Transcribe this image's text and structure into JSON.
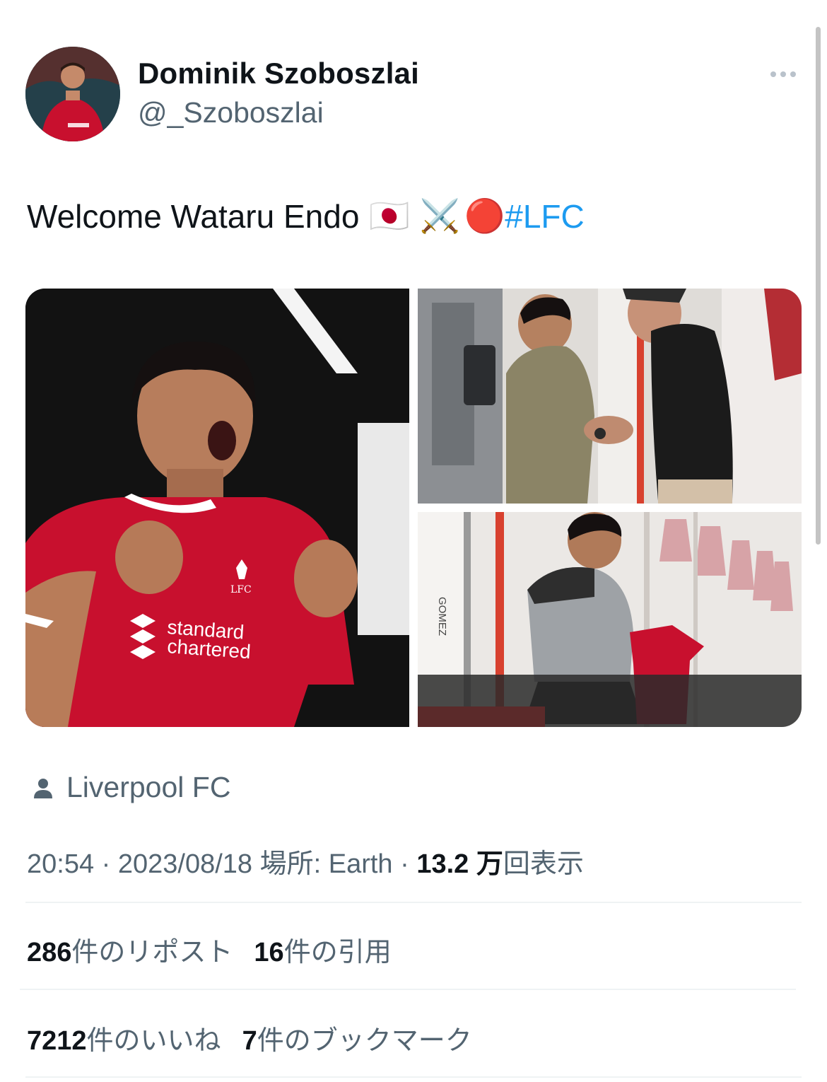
{
  "author": {
    "display_name": "Dominik Szoboszlai",
    "handle": "@_Szoboszlai"
  },
  "tweet": {
    "text": "Welcome Wataru Endo",
    "emojis": [
      "🇯🇵",
      "⚔️",
      "🔴"
    ],
    "hashtag": "#LFC"
  },
  "media": {
    "photo_1_shirt_text": [
      "standard",
      "chartered"
    ],
    "photo_1_crest_text": "LFC",
    "photo_3_locker_name": "GOMEZ"
  },
  "location": {
    "icon": "person-icon",
    "label": "Liverpool FC"
  },
  "meta": {
    "time_date": "20:54 · 2023/08/18",
    "place": "場所: Earth",
    "separator": "·",
    "views_count": "13.2 万",
    "views_label": "回表示"
  },
  "stats": {
    "reposts_count": "286",
    "reposts_label": "件のリポスト",
    "quotes_count": "16",
    "quotes_label": "件の引用",
    "likes_count": "7212",
    "likes_label": "件のいいね",
    "bookmarks_count": "7",
    "bookmarks_label": "件のブックマーク"
  },
  "colors": {
    "accent": "#1d9bf0",
    "text": "#0f1419",
    "secondary_text": "#536471",
    "liverpool_red": "#c8102e"
  }
}
